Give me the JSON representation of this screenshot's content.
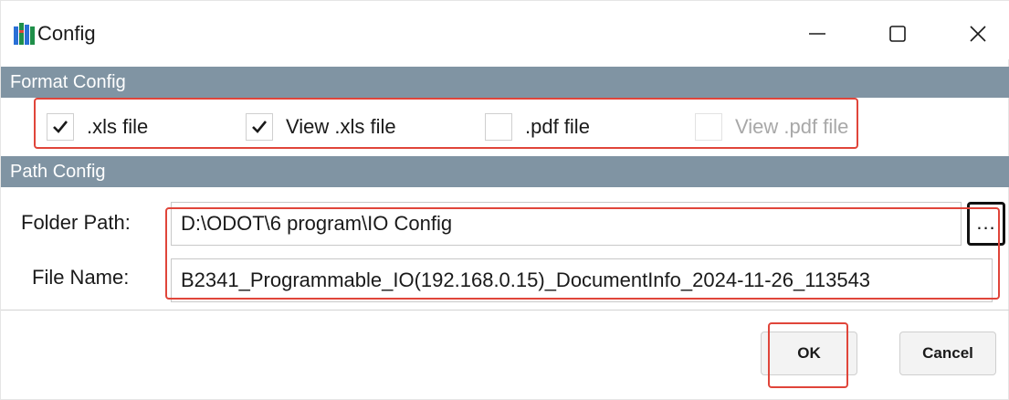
{
  "window": {
    "title": "Config",
    "icons": {
      "app": "app-grid-icon",
      "minimize": "minimize-icon",
      "maximize": "maximize-icon",
      "close": "close-icon"
    }
  },
  "format_config": {
    "header": "Format Config",
    "checkboxes": [
      {
        "label": ".xls file",
        "checked": true,
        "enabled": true
      },
      {
        "label": "View .xls file",
        "checked": true,
        "enabled": true
      },
      {
        "label": ".pdf file",
        "checked": false,
        "enabled": true
      },
      {
        "label": "View .pdf file",
        "checked": false,
        "enabled": false
      }
    ]
  },
  "path_config": {
    "header": "Path Config",
    "folder_label": "Folder Path:",
    "folder_value": "D:\\ODOT\\6 program\\IO Config",
    "browse_label": "...",
    "file_label": "File Name:",
    "file_value": "B2341_Programmable_IO(192.168.0.15)_DocumentInfo_2024-11-26_113543"
  },
  "buttons": {
    "ok": "OK",
    "cancel": "Cancel"
  },
  "colors": {
    "header_bg": "#8094a3",
    "highlight": "#e0453a"
  }
}
